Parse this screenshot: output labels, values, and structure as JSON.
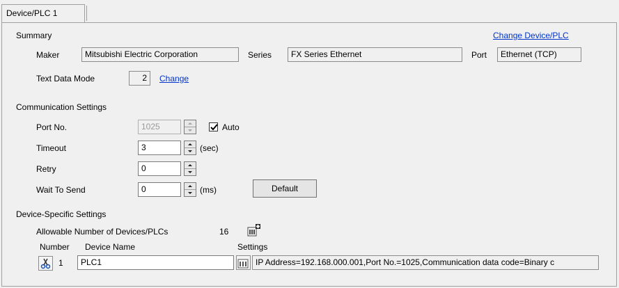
{
  "tab": {
    "label": "Device/PLC 1"
  },
  "summary": {
    "heading": "Summary",
    "change_device_link": "Change Device/PLC",
    "maker_label": "Maker",
    "maker_value": "Mitsubishi Electric Corporation",
    "series_label": "Series",
    "series_value": "FX Series Ethernet",
    "port_label": "Port",
    "port_value": "Ethernet (TCP)",
    "text_data_mode_label": "Text Data Mode",
    "text_data_mode_value": "2",
    "change_link": "Change"
  },
  "communication": {
    "heading": "Communication Settings",
    "port_no_label": "Port No.",
    "port_no_value": "1025",
    "auto_label": "Auto",
    "auto_checked": true,
    "timeout_label": "Timeout",
    "timeout_value": "3",
    "timeout_unit": "(sec)",
    "retry_label": "Retry",
    "retry_value": "0",
    "wait_label": "Wait To Send",
    "wait_value": "0",
    "wait_unit": "(ms)",
    "default_button": "Default"
  },
  "device_specific": {
    "heading": "Device-Specific Settings",
    "allowable_label": "Allowable Number of Devices/PLCs",
    "allowable_value": "16",
    "col_number": "Number",
    "col_device_name": "Device Name",
    "col_settings": "Settings",
    "rows": [
      {
        "number": "1",
        "device_name": "PLC1",
        "settings": "IP Address=192.168.000.001,Port No.=1025,Communication data code=Binary c"
      }
    ]
  },
  "icons": {
    "add_device": "add-device-icon",
    "delete_device": "scissors-icon",
    "settings": "settings-icon"
  }
}
